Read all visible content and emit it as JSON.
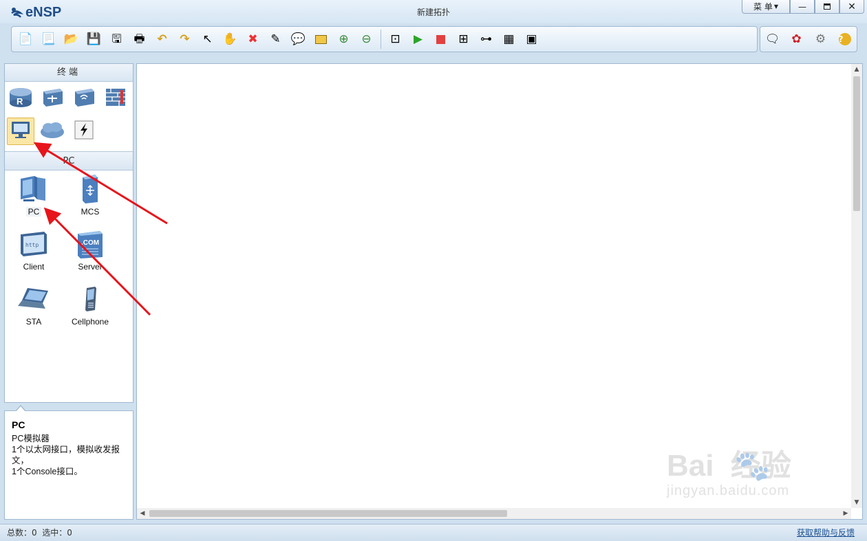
{
  "app": {
    "name": "eNSP",
    "window_title": "新建拓扑",
    "menu_label": "菜 单"
  },
  "toolbar_icons": [
    "new-topology-icon",
    "new-lab-icon",
    "open-icon",
    "save-icon",
    "save-as-icon",
    "print-icon",
    "undo-icon",
    "redo-icon",
    "select-pointer-icon",
    "pan-hand-icon",
    "delete-icon",
    "delete-link-icon",
    "text-annotation-icon",
    "palette-icon",
    "zoom-in-icon",
    "zoom-out-icon",
    "fit-view-icon",
    "start-device-icon",
    "stop-device-icon",
    "capture-icon",
    "topology-icon",
    "grid-icon",
    "screenshot-icon"
  ],
  "left_panel": {
    "category_title": "终端",
    "categories": [
      {
        "icon": "router-icon"
      },
      {
        "icon": "switch-icon"
      },
      {
        "icon": "wireless-icon"
      },
      {
        "icon": "firewall-icon"
      },
      {
        "icon": "terminal-monitor-icon",
        "selected": true
      },
      {
        "icon": "cloud-icon"
      },
      {
        "icon": "connection-icon"
      }
    ],
    "subcategory_title": "PC",
    "devices": [
      {
        "label": "PC",
        "icon": "pc-icon",
        "selected": true
      },
      {
        "label": "MCS",
        "icon": "mcs-server-icon"
      },
      {
        "label": "Client",
        "icon": "client-icon"
      },
      {
        "label": "Server",
        "icon": "server-com-icon"
      },
      {
        "label": "STA",
        "icon": "laptop-icon"
      },
      {
        "label": "Cellphone",
        "icon": "cellphone-icon"
      }
    ]
  },
  "info": {
    "name": "PC",
    "description": "PC模拟器\n1个以太网接口，模拟收发报文，\n1个Console接口。"
  },
  "status": {
    "counts": "总数：0  选中：0",
    "help_link": "获取帮助与反馈"
  },
  "watermark": {
    "brand": "Bai  经验",
    "url": "jingyan.baidu.com"
  },
  "colors": {
    "annotation_arrow": "#e8141b",
    "selected_bg": "#fbe7a6",
    "chrome": "#cfe0ef"
  }
}
